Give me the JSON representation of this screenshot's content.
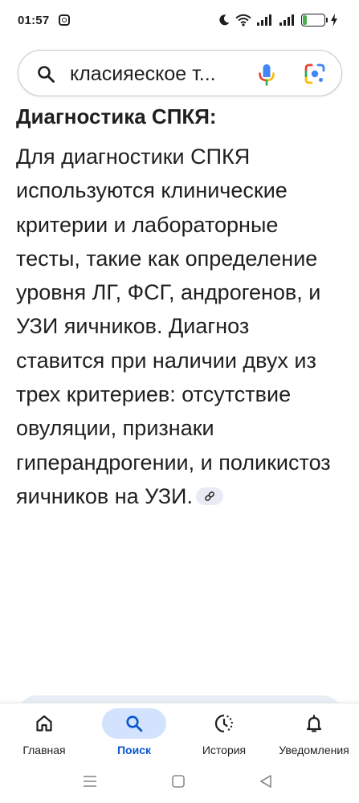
{
  "status_bar": {
    "time": "01:57",
    "battery_level": "19",
    "battery_percent": 19,
    "icons": [
      "instagram-icon",
      "moon-icon",
      "wifi-icon",
      "signal-icon",
      "signal-icon",
      "battery-icon",
      "charging-icon"
    ]
  },
  "search": {
    "query": "класияеское т...",
    "icons": [
      "search-icon",
      "mic-icon",
      "google-lens-icon"
    ]
  },
  "article": {
    "heading": "Диагностика СПКЯ:",
    "body": "Для диагностики СПКЯ используются клинические критерии и лабораторные тесты, такие как определение уровня ЛГ, ФСГ, андрогенов, и УЗИ яичников. Диагноз ставится при наличии двух из трех критериев: отсутствие овуляции, признаки гиперандрогении, и поликистоз яичников на УЗИ.",
    "link_icon": "link-icon"
  },
  "bottom_nav": {
    "items": [
      {
        "label": "Главная",
        "icon": "home-icon",
        "active": false
      },
      {
        "label": "Поиск",
        "icon": "search-icon",
        "active": true
      },
      {
        "label": "История",
        "icon": "history-icon",
        "active": false
      },
      {
        "label": "Уведомления",
        "icon": "bell-icon",
        "active": false
      }
    ]
  },
  "system_nav": {
    "buttons": [
      "menu-icon",
      "home-square-icon",
      "back-triangle-icon"
    ]
  },
  "colors": {
    "accent": "#0b57d0",
    "active_pill": "#d3e3fd",
    "battery_green": "#4caf50",
    "text": "#1f1f1f"
  }
}
